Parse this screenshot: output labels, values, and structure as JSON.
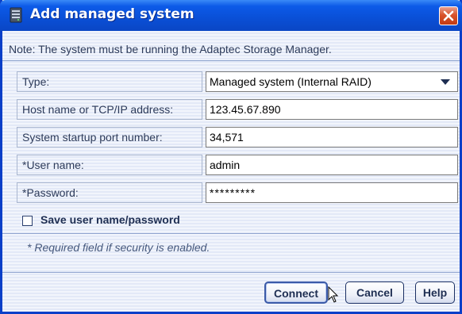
{
  "window": {
    "title": "Add managed system",
    "icon": "server-icon",
    "close_icon": "close-icon",
    "accent": "#0a4fd6"
  },
  "note": "Note: The system must be running the Adaptec Storage Manager.",
  "form": {
    "type_label": "Type:",
    "type_value": "Managed system (Internal RAID)",
    "host_label": "Host name or TCP/IP address:",
    "host_value": "123.45.67.890",
    "port_label": "System startup port number:",
    "port_value": "34,571",
    "user_label": "*User name:",
    "user_value": "admin",
    "password_label": "*Password:",
    "password_value": "*********"
  },
  "save_checkbox": {
    "label": "Save user name/password",
    "checked": false
  },
  "required_note": "* Required field if security is enabled.",
  "buttons": {
    "connect": "Connect",
    "cancel": "Cancel",
    "help": "Help"
  }
}
